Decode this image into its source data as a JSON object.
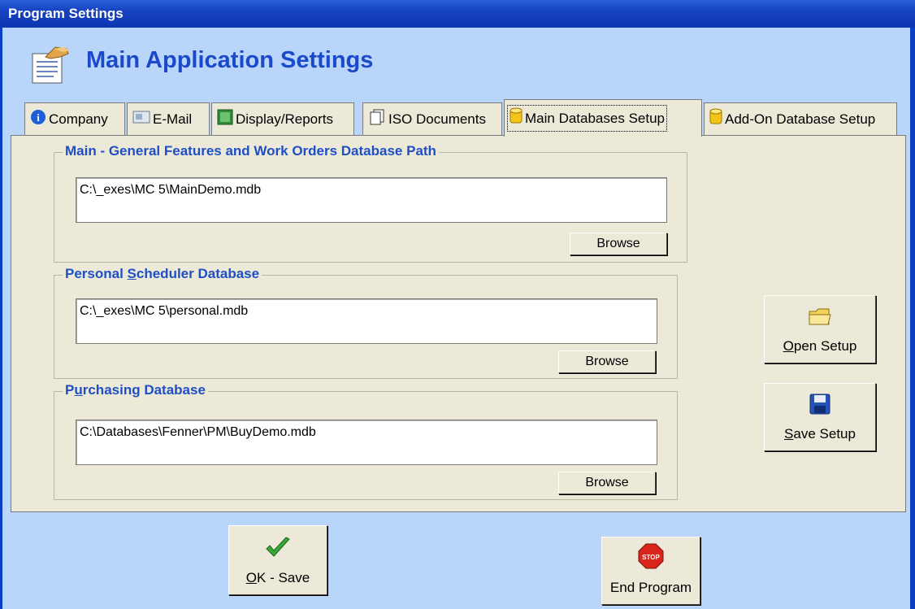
{
  "window": {
    "title": "Program Settings"
  },
  "header": {
    "title": "Main Application Settings",
    "icon": "settings-document-icon"
  },
  "tabs": [
    {
      "label": "Company",
      "icon": "info-icon"
    },
    {
      "label": "E-Mail",
      "icon": "email-icon"
    },
    {
      "label": "Display/Reports",
      "icon": "display-icon"
    },
    {
      "label": "ISO Documents",
      "icon": "documents-icon"
    },
    {
      "label": "Main Databases Setup",
      "icon": "database-icon",
      "active": true
    },
    {
      "label": "Add-On Database Setup",
      "icon": "database-icon"
    }
  ],
  "groups": {
    "main": {
      "label": "Main - General Features and Work Orders Database Path",
      "path": "C:\\_exes\\MC 5\\MainDemo.mdb",
      "browse_label": "Browse"
    },
    "scheduler": {
      "label_pre": "Personal ",
      "label_key": "S",
      "label_post": "cheduler Database",
      "path": "C:\\_exes\\MC 5\\personal.mdb",
      "browse_label": "Browse"
    },
    "purchasing": {
      "label_pre": "P",
      "label_key": "u",
      "label_post": "rchasing Database",
      "path": "C:\\Databases\\Fenner\\PM\\BuyDemo.mdb",
      "browse_label": "Browse"
    }
  },
  "side_buttons": {
    "open": {
      "key": "O",
      "rest": "pen Setup",
      "icon": "folder-icon"
    },
    "save": {
      "key": "S",
      "rest": "ave Setup",
      "icon": "floppy-disk-icon"
    }
  },
  "bottom_buttons": {
    "ok": {
      "key": "O",
      "rest": "K - Save",
      "icon": "checkmark-icon"
    },
    "end": {
      "label": "End Program",
      "icon": "stop-sign-icon",
      "icon_text": "STOP"
    }
  },
  "colors": {
    "titlebar": "#1642c0",
    "background": "#b9d6fa",
    "panel": "#ece9d8",
    "accent_text": "#1e4fc4"
  }
}
